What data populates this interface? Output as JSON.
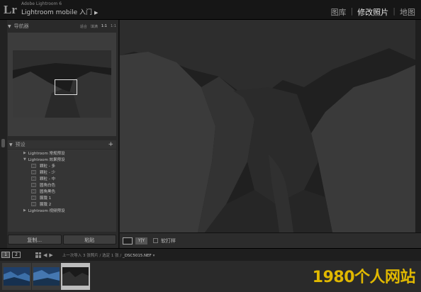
{
  "app": {
    "logo": "Lr",
    "product": "Adobe Lightroom 6",
    "identity": "Lightroom mobile 入门"
  },
  "modules": [
    {
      "label": "图库",
      "active": false
    },
    {
      "label": "修改照片",
      "active": true
    },
    {
      "label": "地图",
      "active": false
    }
  ],
  "navigator": {
    "title": "导航器",
    "zoom_options": [
      "适合",
      "填满",
      "1:1",
      "1:1"
    ],
    "active_zoom": 2
  },
  "presets": {
    "title": "预设",
    "add_label": "+",
    "rows": [
      {
        "type": "folder",
        "label": "Lightroom 常规预设",
        "expanded": false
      },
      {
        "type": "folder",
        "label": "Lightroom 效果预设",
        "expanded": true
      },
      {
        "type": "item",
        "label": "颗粒 - 多",
        "icon": "preset-icon"
      },
      {
        "type": "item",
        "label": "颗粒 - 少",
        "icon": "preset-icon"
      },
      {
        "type": "item",
        "label": "颗粒 - 中",
        "icon": "preset-icon"
      },
      {
        "type": "item",
        "label": "圆角白色",
        "icon": "preset-icon"
      },
      {
        "type": "item",
        "label": "圆角黑色",
        "icon": "preset-icon"
      },
      {
        "type": "item",
        "label": "朦胧 1",
        "icon": "preset-icon"
      },
      {
        "type": "item",
        "label": "朦胧 2",
        "icon": "preset-icon"
      },
      {
        "type": "folder",
        "label": "Lightroom 视频预设",
        "expanded": false
      }
    ]
  },
  "panel_buttons": {
    "copy": "复制...",
    "paste": "粘贴"
  },
  "toolbar": {
    "yy_label": "Y|Y",
    "soft_proof_label": "软打样"
  },
  "filmbar": {
    "screen1": "1",
    "screen2": "2",
    "source": "上一次导入",
    "count": "3 张照片 / 选定 1 张 /",
    "filename": "_DSC5015.NEF",
    "dropdown": "▾"
  },
  "filmstrip": {
    "thumbnails": 3,
    "selected_index": 2
  },
  "watermark": "1980个人网站",
  "colors": {
    "active_module": "#e6e6e6",
    "watermark": "#e0b800",
    "selected_cell": "#bdbdbd"
  }
}
